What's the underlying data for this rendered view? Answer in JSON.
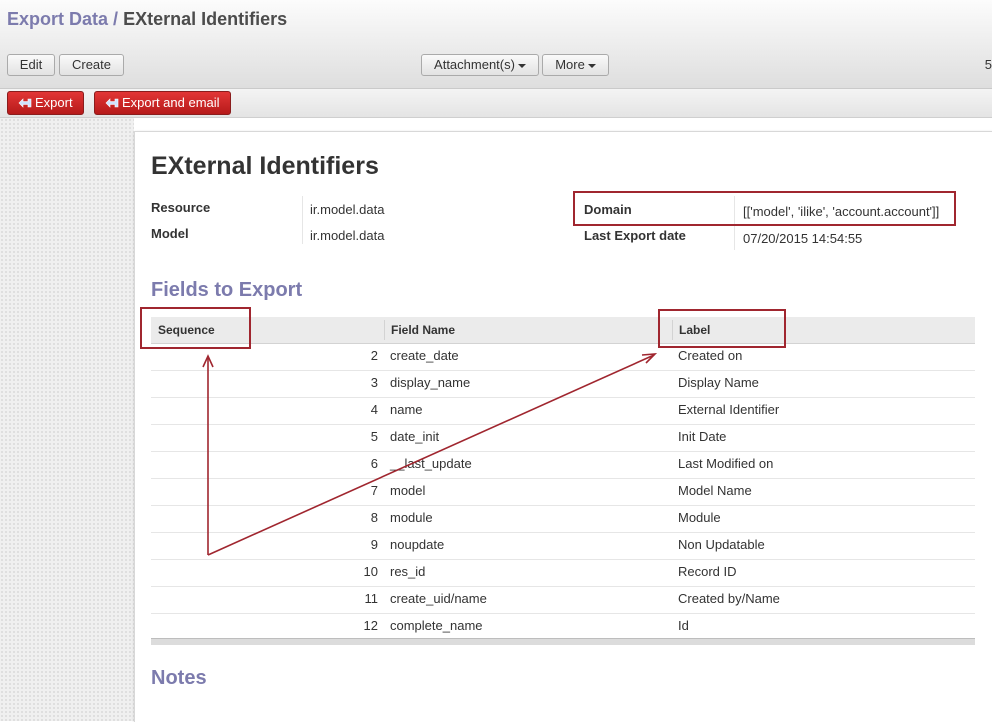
{
  "header": {
    "breadcrumb_parent": "Export Data",
    "breadcrumb_separator": "/",
    "breadcrumb_current": "EXternal Identifiers"
  },
  "toolbar": {
    "edit_label": "Edit",
    "create_label": "Create",
    "attachments_label": "Attachment(s)",
    "more_label": "More",
    "pager_text": "5"
  },
  "actions": {
    "export_label": "Export",
    "export_email_label": "Export and email"
  },
  "form": {
    "title": "EXternal Identifiers",
    "resource_label": "Resource",
    "resource_value": "ir.model.data",
    "model_label": "Model",
    "model_value": "ir.model.data",
    "domain_label": "Domain",
    "domain_value": "[['model', 'ilike', 'account.account']]",
    "last_export_label": "Last Export date",
    "last_export_value": "07/20/2015 14:54:55"
  },
  "fields_section": {
    "title": "Fields to Export",
    "columns": {
      "sequence": "Sequence",
      "field_name": "Field Name",
      "label": "Label"
    },
    "rows": [
      {
        "seq": "2",
        "field": "create_date",
        "label": "Created on"
      },
      {
        "seq": "3",
        "field": "display_name",
        "label": "Display Name"
      },
      {
        "seq": "4",
        "field": "name",
        "label": "External Identifier"
      },
      {
        "seq": "5",
        "field": "date_init",
        "label": "Init Date"
      },
      {
        "seq": "6",
        "field": "__last_update",
        "label": "Last Modified on"
      },
      {
        "seq": "7",
        "field": "model",
        "label": "Model Name"
      },
      {
        "seq": "8",
        "field": "module",
        "label": "Module"
      },
      {
        "seq": "9",
        "field": "noupdate",
        "label": "Non Updatable"
      },
      {
        "seq": "10",
        "field": "res_id",
        "label": "Record ID"
      },
      {
        "seq": "11",
        "field": "create_uid/name",
        "label": "Created by/Name"
      },
      {
        "seq": "12",
        "field": "complete_name",
        "label": "Id"
      }
    ]
  },
  "notes_section": {
    "title": "Notes"
  },
  "colors": {
    "accent": "#7c7bad",
    "export_button": "#c9262b",
    "annotation": "#a0262f"
  },
  "icons": {
    "export_icon": "export-arrow-icon",
    "caret": "caret-down-icon"
  }
}
